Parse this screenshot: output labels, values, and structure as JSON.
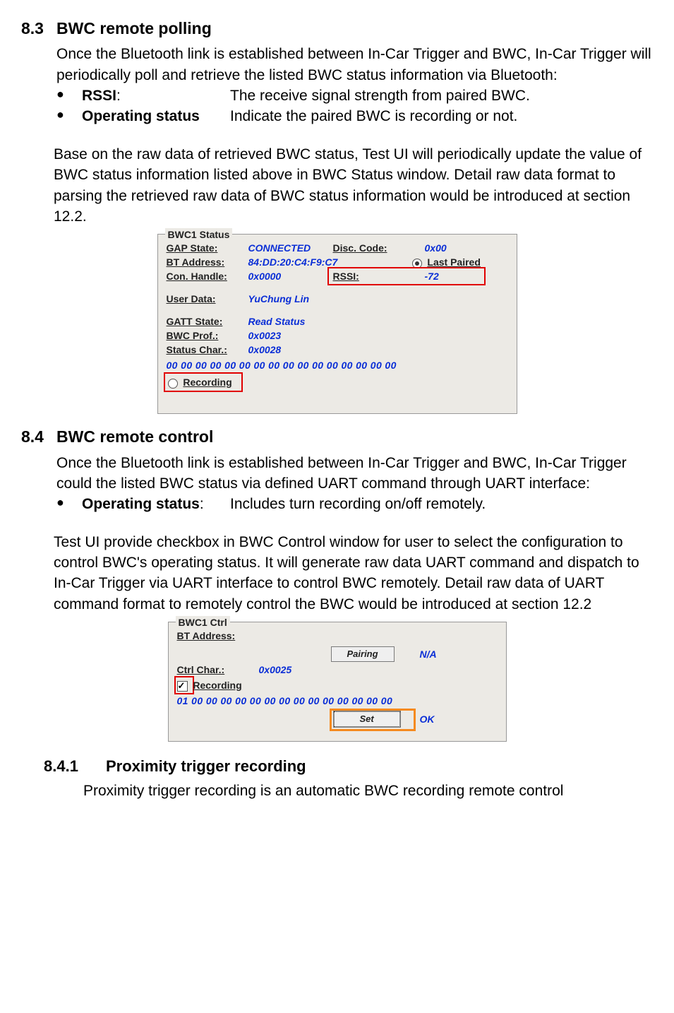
{
  "s83": {
    "heading_num": "8.3",
    "heading_text": "BWC remote polling",
    "intro": "Once the Bluetooth link is established between In-Car Trigger and BWC, In-Car Trigger will periodically poll and retrieve the listed BWC status information via Bluetooth:",
    "bullets": [
      {
        "term": "RSSI",
        "term_suffix": ":",
        "desc": "The receive signal strength from paired BWC."
      },
      {
        "term": "Operating status",
        "term_suffix": "",
        "desc": "Indicate the paired BWC is recording or not."
      }
    ],
    "para": "Base on the raw data of retrieved BWC status, Test UI will periodically update the value of BWC status information listed above in BWC Status window. Detail raw data format to parsing the retrieved raw data of BWC status information would be introduced at section 12.2."
  },
  "status_box": {
    "title": "BWC1 Status",
    "gap_state_lbl": "GAP State:",
    "gap_state_val": "CONNECTED",
    "disc_code_lbl": "Disc. Code:",
    "disc_code_val": "0x00",
    "bt_addr_lbl": "BT Address:",
    "bt_addr_val": "84:DD:20:C4:F9:C7",
    "last_paired": "Last Paired",
    "con_handle_lbl": "Con. Handle:",
    "con_handle_val": "0x0000",
    "rssi_lbl": "RSSI:",
    "rssi_val": "-72",
    "user_data_lbl": "User Data:",
    "user_data_val": "YuChung Lin",
    "gatt_state_lbl": "GATT State:",
    "gatt_state_val": "Read Status",
    "bwc_prof_lbl": "BWC Prof.:",
    "bwc_prof_val": "0x0023",
    "status_char_lbl": "Status Char.:",
    "status_char_val": "0x0028",
    "hex": "00 00 00 00 00 00 00 00 00 00 00 00 00 00 00 00",
    "recording": "Recording"
  },
  "s84": {
    "heading_num": "8.4",
    "heading_text": "BWC remote control",
    "intro": "Once the Bluetooth link is established between In-Car Trigger and BWC, In-Car Trigger could the listed BWC status via defined UART command through UART interface:",
    "bullets": [
      {
        "term": "Operating status",
        "term_suffix": ":",
        "desc": "Includes turn recording on/off remotely."
      }
    ],
    "para": "Test UI provide checkbox in BWC Control window for user to select the configuration to control BWC's operating status. It will generate raw data UART command and dispatch to In-Car Trigger via UART interface to control BWC remotely. Detail raw data of UART command format to remotely control the BWC would be introduced at section 12.2"
  },
  "ctrl_box": {
    "title": "BWC1 Ctrl",
    "bt_addr_lbl": "BT Address:",
    "pairing_btn": "Pairing",
    "pairing_status": "N/A",
    "ctrl_char_lbl": "Ctrl Char.:",
    "ctrl_char_val": "0x0025",
    "recording": "Recording",
    "hex": "01 00 00 00 00 00 00 00 00 00 00 00 00 00 00",
    "set_btn": "Set",
    "set_status": "OK"
  },
  "s841": {
    "heading_num": "8.4.1",
    "heading_text": "Proximity trigger recording",
    "intro": "Proximity trigger recording is an automatic BWC recording remote control"
  }
}
